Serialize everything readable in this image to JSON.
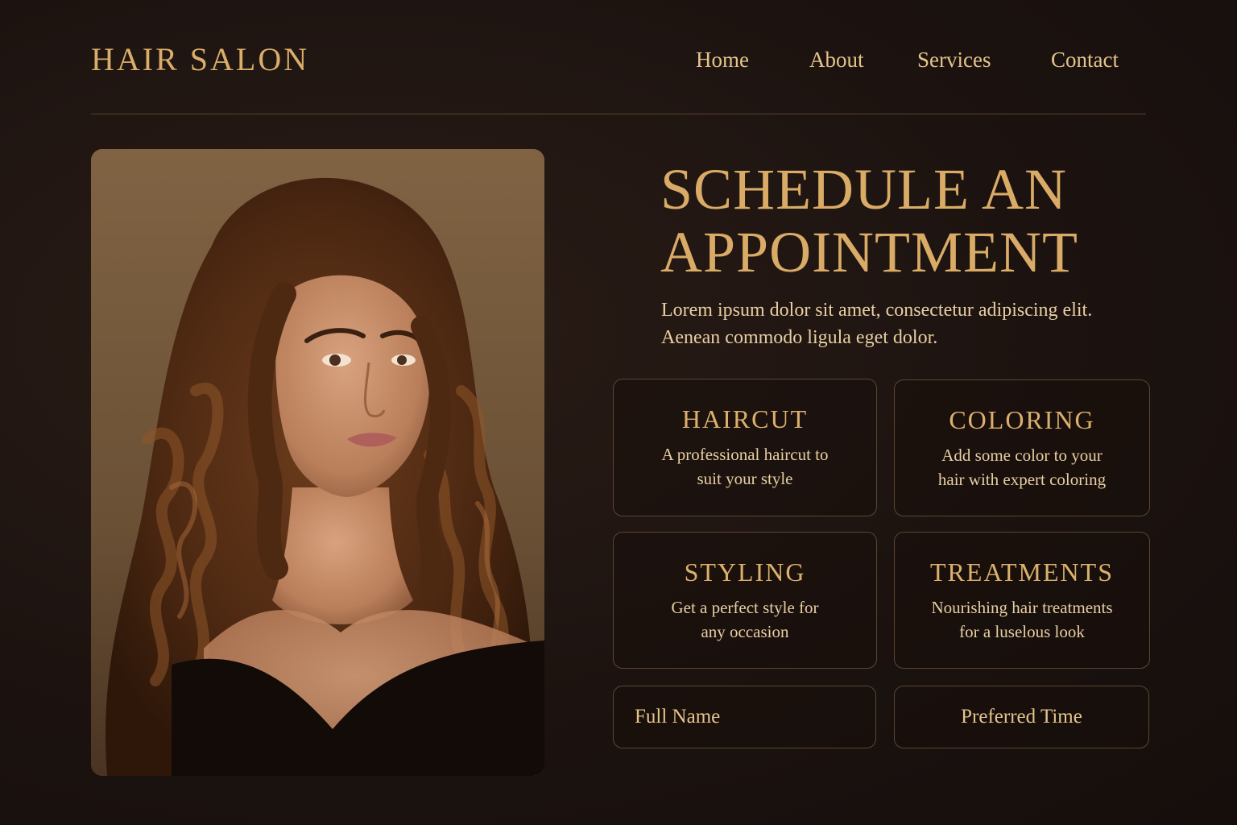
{
  "brand": "HAIR SALON",
  "nav": {
    "home": "Home",
    "about": "About",
    "services": "Services",
    "contact": "Contact"
  },
  "hero": {
    "image": "portrait-woman-long-wavy-hair"
  },
  "appointment": {
    "headline_line1": "SCHEDULE AN",
    "headline_line2": "APPOINTMENT",
    "intro_line1": "Lorem ipsum dolor sit amet, consectetur adipiscing elit.",
    "intro_line2": "Aenean commodo ligula eget dolor."
  },
  "services": [
    {
      "title": "HAIRCUT",
      "desc_line1": "A professional haircut to",
      "desc_line2": "suit your style"
    },
    {
      "title": "COLORING",
      "desc_line1": "Add some color to your",
      "desc_line2": "hair with expert coloring"
    },
    {
      "title": "STYLING",
      "desc_line1": "Get a perfect style for",
      "desc_line2": "any occasion"
    },
    {
      "title": "TREATMENTS",
      "desc_line1": "Nourishing hair treatments",
      "desc_line2": "for a luselous look"
    }
  ],
  "form": {
    "name_placeholder": "Full Name",
    "time_placeholder": "Preferred Time"
  },
  "colors": {
    "background": "#1c1310",
    "accent_gold": "#d9ab66",
    "text_cream": "#e8cfa3",
    "border": "#5d4532"
  }
}
